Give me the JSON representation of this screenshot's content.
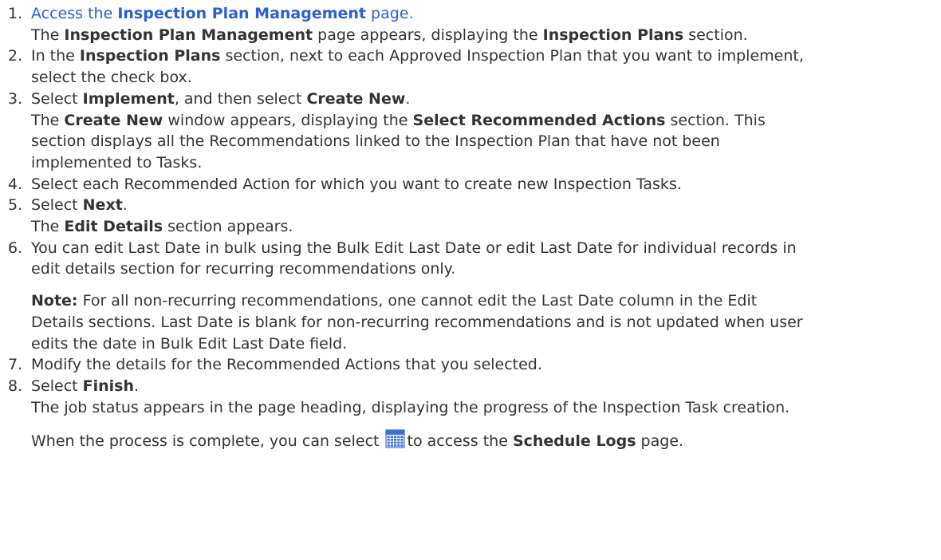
{
  "steps": [
    {
      "num": "1.",
      "lines": [
        [
          {
            "t": "Access the ",
            "s": "link"
          },
          {
            "t": "Inspection Plan Management",
            "s": "linkbold"
          },
          {
            "t": " page.",
            "s": "link"
          }
        ],
        [
          {
            "t": "The ",
            "s": "plain"
          },
          {
            "t": "Inspection Plan Management",
            "s": "bold"
          },
          {
            "t": " page appears, displaying the ",
            "s": "plain"
          },
          {
            "t": "Inspection Plans",
            "s": "bold"
          },
          {
            "t": " section.",
            "s": "plain"
          }
        ]
      ]
    },
    {
      "num": "2.",
      "lines": [
        [
          {
            "t": "In the ",
            "s": "plain"
          },
          {
            "t": "Inspection Plans",
            "s": "bold"
          },
          {
            "t": " section, next to each Approved Inspection Plan that you want to implement,",
            "s": "plain"
          }
        ],
        [
          {
            "t": "select the check box.",
            "s": "plain"
          }
        ]
      ]
    },
    {
      "num": "3.",
      "lines": [
        [
          {
            "t": "Select ",
            "s": "plain"
          },
          {
            "t": "Implement",
            "s": "bold"
          },
          {
            "t": ", and then select ",
            "s": "plain"
          },
          {
            "t": "Create New",
            "s": "bold"
          },
          {
            "t": ".",
            "s": "plain"
          }
        ],
        [
          {
            "t": "The ",
            "s": "plain"
          },
          {
            "t": "Create New",
            "s": "bold"
          },
          {
            "t": " window appears, displaying the ",
            "s": "plain"
          },
          {
            "t": "Select Recommended Actions",
            "s": "bold"
          },
          {
            "t": " section. This",
            "s": "plain"
          }
        ],
        [
          {
            "t": "section displays all the Recommendations linked to the Inspection Plan that have not been",
            "s": "plain"
          }
        ],
        [
          {
            "t": "implemented to Tasks.",
            "s": "plain"
          }
        ]
      ]
    },
    {
      "num": "4.",
      "lines": [
        [
          {
            "t": "Select each Recommended Action for which you want to create new Inspection Tasks.",
            "s": "plain"
          }
        ]
      ]
    },
    {
      "num": "5.",
      "lines": [
        [
          {
            "t": "Select ",
            "s": "plain"
          },
          {
            "t": "Next",
            "s": "bold"
          },
          {
            "t": ".",
            "s": "plain"
          }
        ],
        [
          {
            "t": "The ",
            "s": "plain"
          },
          {
            "t": "Edit Details",
            "s": "bold"
          },
          {
            "t": " section appears.",
            "s": "plain"
          }
        ]
      ]
    },
    {
      "num": "6.",
      "lines": [
        [
          {
            "t": "You can edit Last Date in bulk using the Bulk Edit Last Date or edit Last Date for individual records in",
            "s": "plain"
          }
        ],
        [
          {
            "t": "edit details section for recurring recommendations only.",
            "s": "plain"
          }
        ],
        [
          {
            "t": "Note:",
            "s": "bold",
            "gap": true
          },
          {
            "t": " For all non-recurring recommendations, one cannot edit the Last Date column in the Edit",
            "s": "plain"
          }
        ],
        [
          {
            "t": "Details sections. Last Date is blank for non-recurring recommendations and is not updated when user",
            "s": "plain"
          }
        ],
        [
          {
            "t": "edits the date in Bulk Edit Last Date field.",
            "s": "plain"
          }
        ]
      ]
    },
    {
      "num": "7.",
      "lines": [
        [
          {
            "t": "Modify the details for the Recommended Actions that you selected.",
            "s": "plain"
          }
        ]
      ]
    },
    {
      "num": "8.",
      "lines": [
        [
          {
            "t": "Select ",
            "s": "plain"
          },
          {
            "t": "Finish",
            "s": "bold"
          },
          {
            "t": ".",
            "s": "plain"
          }
        ],
        [
          {
            "t": "The job status appears in the page heading, displaying the progress of the Inspection Task creation.",
            "s": "plain"
          }
        ],
        [
          {
            "t": "When the process is complete, you can select ",
            "s": "plain",
            "gap": true
          },
          {
            "icon": "schedule-calendar-icon"
          },
          {
            "t": "to access the ",
            "s": "plain"
          },
          {
            "t": "Schedule Logs",
            "s": "bold"
          },
          {
            "t": " page.",
            "s": "plain"
          }
        ]
      ]
    }
  ],
  "colors": {
    "text": "#333333",
    "link": "#2a5fd6",
    "icon": "#3b6fd8"
  }
}
